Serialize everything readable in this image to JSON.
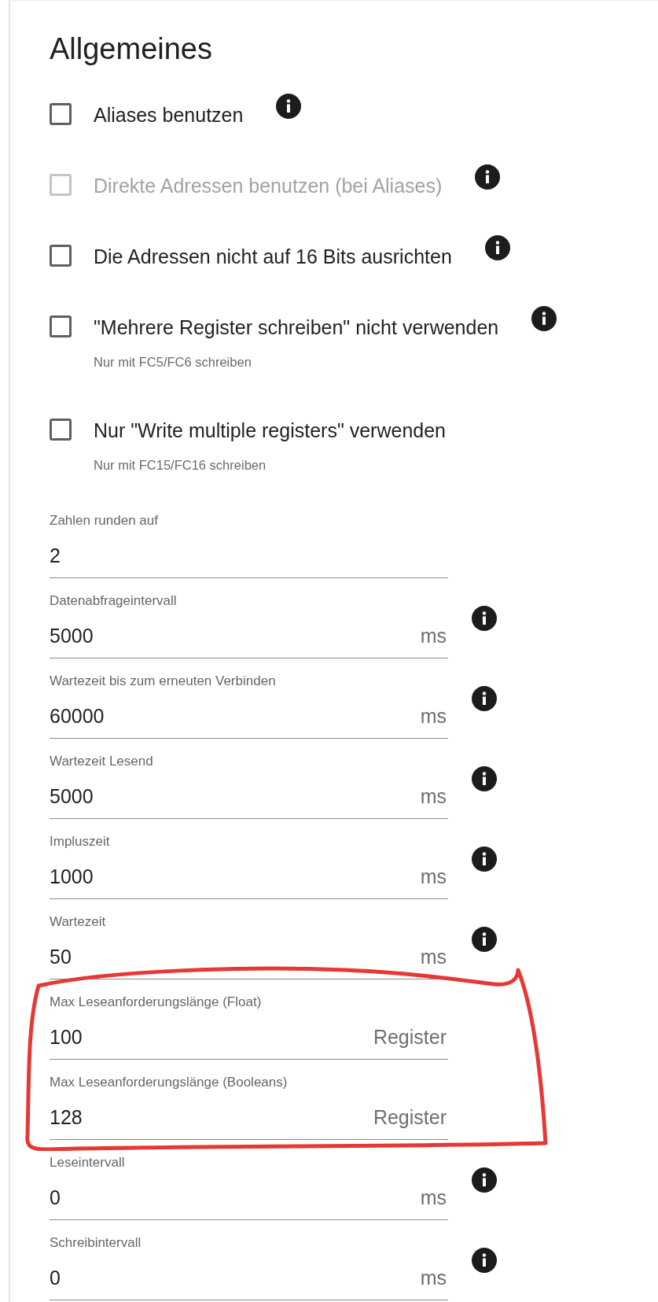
{
  "section": {
    "title": "Allgemeines"
  },
  "options": [
    {
      "label": "Aliases benutzen",
      "checked": false,
      "disabled": false,
      "info": true
    },
    {
      "label": "Direkte Adressen benutzen (bei Aliases)",
      "checked": false,
      "disabled": true,
      "info": true
    },
    {
      "label": "Die Adressen nicht auf 16 Bits ausrichten",
      "checked": false,
      "disabled": false,
      "info": true
    },
    {
      "label": "\"Mehrere Register schreiben\" nicht verwenden",
      "checked": false,
      "disabled": false,
      "info": true,
      "hint": "Nur mit FC5/FC6 schreiben"
    },
    {
      "label": "Nur \"Write multiple registers\" verwenden",
      "checked": false,
      "disabled": false,
      "info": false,
      "hint": "Nur mit FC15/FC16 schreiben"
    }
  ],
  "fields": [
    {
      "label": "Zahlen runden auf",
      "value": "2",
      "info": false
    },
    {
      "label": "Datenabfrageintervall",
      "value": "5000",
      "unit": "ms",
      "info": true
    },
    {
      "label": "Wartezeit bis zum erneuten Verbinden",
      "value": "60000",
      "unit": "ms",
      "info": true
    },
    {
      "label": "Wartezeit Lesend",
      "value": "5000",
      "unit": "ms",
      "info": true
    },
    {
      "label": "Impluszeit",
      "value": "1000",
      "unit": "ms",
      "info": true
    },
    {
      "label": "Wartezeit",
      "value": "50",
      "unit": "ms",
      "info": true
    },
    {
      "label": "Max Leseanforderungslänge (Float)",
      "value": "100",
      "unit": "Register",
      "info": false
    },
    {
      "label": "Max Leseanforderungslänge (Booleans)",
      "value": "128",
      "unit": "Register",
      "info": false
    },
    {
      "label": "Leseintervall",
      "value": "0",
      "unit": "ms",
      "info": true
    },
    {
      "label": "Schreibintervall",
      "value": "0",
      "unit": "ms",
      "info": true
    }
  ]
}
